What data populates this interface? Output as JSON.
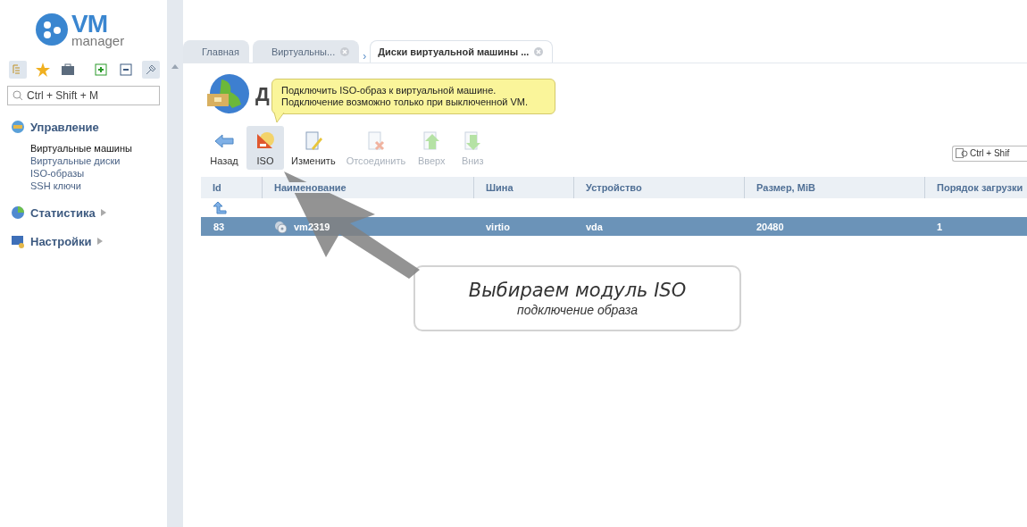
{
  "logo": {
    "title": "VM",
    "subtitle": "manager"
  },
  "sidebar": {
    "search": {
      "placeholder": "Ctrl + Shift + M"
    },
    "sections": [
      {
        "title": "Управление",
        "expanded": true,
        "items": [
          {
            "label": "Виртуальные машины",
            "selected": true
          },
          {
            "label": "Виртуальные диски",
            "selected": false
          },
          {
            "label": "ISO-образы",
            "selected": false
          },
          {
            "label": "SSH ключи",
            "selected": false
          }
        ]
      },
      {
        "title": "Статистика",
        "expanded": false
      },
      {
        "title": "Настройки",
        "expanded": false
      }
    ]
  },
  "tabs": [
    {
      "label": "Главная",
      "selected": false,
      "closable": false
    },
    {
      "label": "Виртуальны...",
      "selected": false,
      "closable": true
    },
    {
      "label": "Диски виртуальной машины ...",
      "selected": true,
      "closable": true
    }
  ],
  "tab_separator": "›",
  "page": {
    "title": "Д"
  },
  "tooltip": {
    "lines": [
      "Подключить ISO-образ к виртуальной машине.",
      "Подключение возможно только при выключенной VM."
    ]
  },
  "toolbar": [
    {
      "kind": "back",
      "label": "Назад",
      "disabled": false,
      "selected": false
    },
    {
      "kind": "iso",
      "label": "ISO",
      "disabled": false,
      "selected": true
    },
    {
      "kind": "edit",
      "label": "Изменить",
      "disabled": false,
      "selected": false
    },
    {
      "kind": "detach",
      "label": "Отсоединить",
      "disabled": true,
      "selected": false
    },
    {
      "kind": "up",
      "label": "Вверх",
      "disabled": true,
      "selected": false
    },
    {
      "kind": "down",
      "label": "Вниз",
      "disabled": true,
      "selected": false
    }
  ],
  "table_search": {
    "placeholder": "Ctrl + Shif"
  },
  "table": {
    "columns": [
      "Id",
      "Наименование",
      "Шина",
      "Устройство",
      "Размер, MiB",
      "Порядок загрузки"
    ],
    "rows": [
      {
        "cells": [
          "83",
          "vm2319",
          "virtio",
          "vda",
          "20480",
          "1"
        ],
        "selected": true
      }
    ]
  },
  "callout": {
    "title": "Выбираем модуль ISO",
    "subtitle": "подключение образа"
  }
}
